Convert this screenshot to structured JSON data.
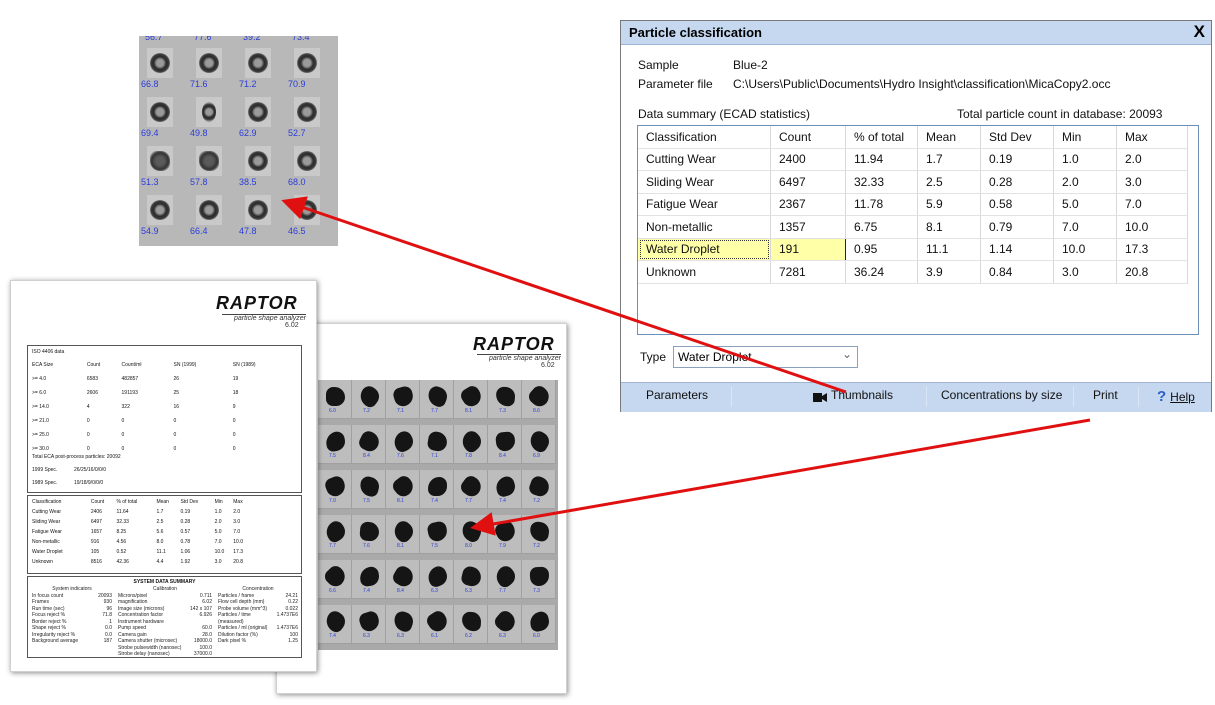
{
  "thumbnails": {
    "top_partial_values": [
      "56.7",
      "77.6",
      "39.2",
      "73.4"
    ],
    "values": [
      "66.8",
      "71.6",
      "71.2",
      "70.9",
      "69.4",
      "49.8",
      "62.9",
      "52.7",
      "51.3",
      "57.8",
      "38.5",
      "68.0",
      "54.9",
      "66.4",
      "47.8",
      "46.5"
    ]
  },
  "report_front": {
    "logo": "RAPTOR",
    "subtitle": "particle shape analyzer",
    "version": "6.02",
    "iso": {
      "title": "ISO 4406 data",
      "headers": [
        "ECA Size",
        "Count",
        "Count/ml",
        "SN (1999)",
        "SN (1989)"
      ],
      "rows": [
        [
          ">= 4.0",
          "6583",
          "482857",
          "26",
          "19"
        ],
        [
          ">= 6.0",
          "2606",
          "191193",
          "25",
          "18"
        ],
        [
          ">= 14.0",
          "4",
          "322",
          "16",
          "9"
        ],
        [
          ">= 21.0",
          "0",
          "0",
          "0",
          "0"
        ],
        [
          ">= 25.0",
          "0",
          "0",
          "0",
          "0"
        ],
        [
          ">= 30.0",
          "0",
          "0",
          "0",
          "0"
        ]
      ],
      "total": "Total ECA post-process particles: 20092",
      "spec1999_label": "1999 Spec.",
      "spec1999": "26/25/16/0/0/0",
      "spec1989_label": "1989 Spec.",
      "spec1989": "19/18/9/0/0/0"
    },
    "classification": {
      "headers": [
        "Classification",
        "Count",
        "% of total",
        "Mean",
        "Std Dev",
        "Min",
        "Max"
      ],
      "rows": [
        [
          "Cutting Wear",
          "2406",
          "11.64",
          "1.7",
          "0.19",
          "1.0",
          "2.0"
        ],
        [
          "Sliding Wear",
          "6497",
          "32.33",
          "2.5",
          "0.28",
          "2.0",
          "3.0"
        ],
        [
          "Fatigue Wear",
          "1657",
          "8.25",
          "5.6",
          "0.57",
          "5.0",
          "7.0"
        ],
        [
          "Non-metallic",
          "916",
          "4.56",
          "8.0",
          "0.78",
          "7.0",
          "10.0"
        ],
        [
          "Water Droplet",
          "105",
          "0.52",
          "11.1",
          "1.06",
          "10.0",
          "17.3"
        ],
        [
          "Unknown",
          "8516",
          "42.36",
          "4.4",
          "1.92",
          "3.0",
          "20.8"
        ]
      ]
    },
    "system": {
      "title": "SYSTEM DATA SUMMARY",
      "col_titles": [
        "System indicators",
        "Calibration",
        "Concentration"
      ],
      "col1": [
        [
          "In focus count",
          "20093"
        ],
        [
          "Frames",
          "930"
        ],
        [
          "Run time (sec)",
          "96"
        ],
        [
          "Focus reject %",
          "71.8"
        ],
        [
          "Border reject %",
          "1"
        ],
        [
          "Shape reject %",
          "0.0"
        ],
        [
          "Irregularity reject %",
          "0.0"
        ],
        [
          "Background average",
          "187"
        ]
      ],
      "col2": [
        [
          "Microns/pixel",
          "0.711"
        ],
        [
          "magnification",
          "6.02"
        ],
        [
          "Image size (microns)",
          "142 x 107"
        ],
        [
          "Concentration factor",
          "6.926"
        ],
        [
          "",
          ""
        ],
        [
          "Instrument hardware",
          ""
        ],
        [
          "Pump speed",
          "60.0"
        ],
        [
          "Camera gain",
          "28.0"
        ],
        [
          "Camera shutter (microsec)",
          "18000.0"
        ],
        [
          "Strobe pulsewidth (nanosec)",
          "100.0"
        ],
        [
          "Strobe delay (nanosec)",
          "37000.0"
        ]
      ],
      "col3": [
        [
          "Particles / frame",
          "24.21"
        ],
        [
          "Flow cell depth (mm)",
          "0.22"
        ],
        [
          "Probe volume (mm^3)",
          "0.022"
        ],
        [
          "Particles / time (measured)",
          "1.4737E6"
        ],
        [
          "Particles / ml (original)",
          "1.4737E6"
        ],
        [
          "Dilution factor (%)",
          "100"
        ],
        [
          "Dark pixel %",
          "1.25"
        ]
      ]
    }
  },
  "report_back": {
    "logo": "RAPTOR",
    "subtitle": "particle shape analyzer",
    "version": "6.02",
    "values": [
      "6.0",
      "7.2",
      "7.1",
      "7.7",
      "8.1",
      "7.3",
      "8.6",
      "7.5",
      "8.4",
      "7.6",
      "7.1",
      "7.8",
      "8.4",
      "6.9",
      "7.0",
      "7.5",
      "8.1",
      "7.4",
      "7.7",
      "7.4",
      "7.2",
      "7.7",
      "7.6",
      "8.1",
      "7.5",
      "8.0",
      "7.9",
      "7.2",
      "6.6",
      "7.4",
      "8.4",
      "6.3",
      "6.3",
      "7.7",
      "7.3",
      "7.4",
      "6.3",
      "6.3",
      "6.1",
      "6.2",
      "6.3",
      "6.0"
    ]
  },
  "dialog": {
    "title": "Particle classification",
    "close": "X",
    "sample_label": "Sample",
    "sample_value": "Blue-2",
    "param_label": "Parameter file",
    "param_value": "C:\\Users\\Public\\Documents\\Hydro Insight\\classification\\MicaCopy2.occ",
    "summary_label": "Data summary  (ECAD statistics)",
    "total_label": "Total particle count in database:  20093",
    "columns": [
      "Classification",
      "Count",
      "% of total",
      "Mean",
      "Std Dev",
      "Min",
      "Max"
    ],
    "rows": [
      [
        "Cutting Wear",
        "2400",
        "11.94",
        "1.7",
        "0.19",
        "1.0",
        "2.0"
      ],
      [
        "Sliding Wear",
        "6497",
        "32.33",
        "2.5",
        "0.28",
        "2.0",
        "3.0"
      ],
      [
        "Fatigue Wear",
        "2367",
        "11.78",
        "5.9",
        "0.58",
        "5.0",
        "7.0"
      ],
      [
        "Non-metallic",
        "1357",
        "6.75",
        "8.1",
        "0.79",
        "7.0",
        "10.0"
      ],
      [
        "Water Droplet",
        "191",
        "0.95",
        "11.1",
        "1.14",
        "10.0",
        "17.3"
      ],
      [
        "Unknown",
        "7281",
        "36.24",
        "3.9",
        "0.84",
        "3.0",
        "20.8"
      ]
    ],
    "selected_row": "Water Droplet",
    "type_label": "Type",
    "type_value": "Water Droplet",
    "buttons": {
      "parameters": "Parameters",
      "thumbnails": "Thumbnails",
      "concentrations": "Concentrations by size",
      "print": "Print",
      "help_glyph": "?",
      "help": "Help"
    }
  },
  "colors": {
    "title_bar": "#c5d8ef",
    "highlight": "#ffffa8",
    "arrow": "#e01010",
    "thumb_number": "#2a3cd8"
  }
}
